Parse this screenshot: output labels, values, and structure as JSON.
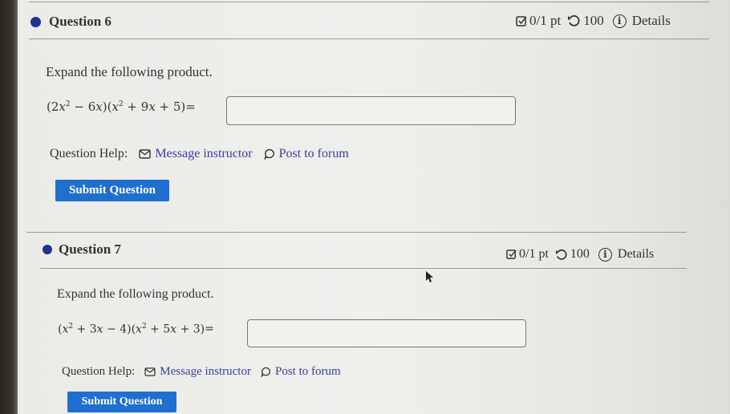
{
  "questions": [
    {
      "title": "Question 6",
      "score": "0/1 pt",
      "retries": "100",
      "details_label": "Details",
      "prompt": "Expand the following product.",
      "expression": {
        "factor1": [
          "(2",
          "x",
          "2",
          " − 6",
          "x",
          ")"
        ],
        "factor2": [
          "(",
          "x",
          "2",
          " + 9",
          "x",
          " + 5)"
        ],
        "equals": " ="
      },
      "answer_value": "",
      "help_label": "Question Help:",
      "message_label": "Message instructor",
      "forum_label": "Post to forum",
      "submit_label": "Submit Question"
    },
    {
      "title": "Question 7",
      "score": "0/1 pt",
      "retries": "100",
      "details_label": "Details",
      "prompt": "Expand the following product.",
      "expression": {
        "factor1": [
          "(",
          "x",
          "2",
          " + 3",
          "x",
          " − 4)"
        ],
        "factor2": [
          "(",
          "x",
          "2",
          " + 5",
          "x",
          " + 3)"
        ],
        "equals": " ="
      },
      "answer_value": "",
      "help_label": "Question Help:",
      "message_label": "Message instructor",
      "forum_label": "Post to forum",
      "submit_label": "Submit Question"
    }
  ],
  "icons": {
    "status_dot": "bullet-dot",
    "score": "checkbox-edit-icon",
    "retries": "undo-icon",
    "details": "info-icon",
    "message": "envelope-icon",
    "forum": "speech-bubble-icon"
  },
  "colors": {
    "accent_dot": "#23318f",
    "submit_bg": "#1f6fcf",
    "link": "#3a3f9e"
  }
}
